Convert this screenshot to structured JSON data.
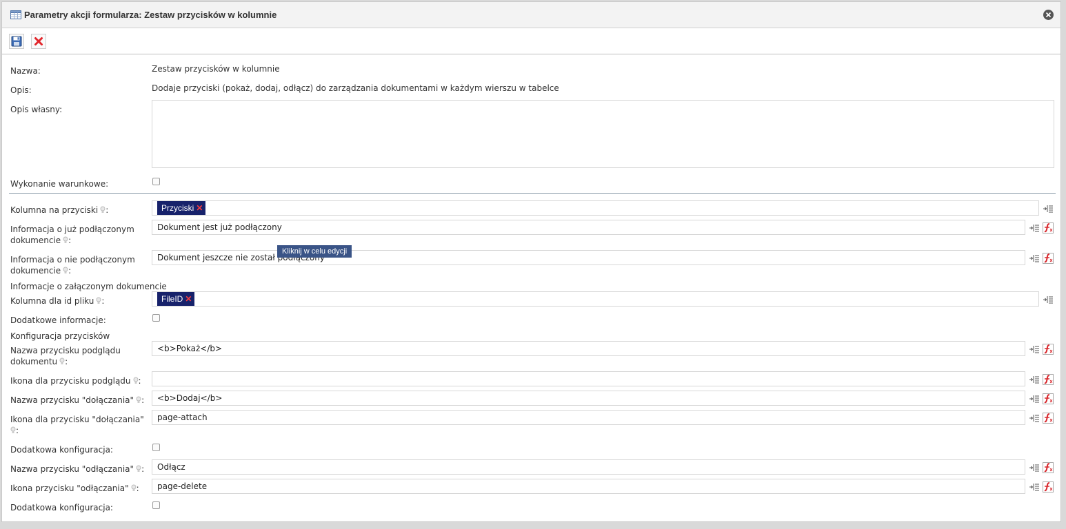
{
  "dialog": {
    "title": "Parametry akcji formularza: Zestaw przycisków w kolumnie"
  },
  "toolbar": {
    "save_icon": "save-disk-icon",
    "cancel_icon": "red-x-icon"
  },
  "fields": {
    "name_label": "Nazwa:",
    "name_value": "Zestaw przycisków w kolumnie",
    "desc_label": "Opis:",
    "desc_value": "Dodaje przyciski (pokaż, dodaj, odłącz) do zarządzania dokumentami w każdym wierszu w tabelce",
    "own_desc_label": "Opis własny:",
    "conditional_label": "Wykonanie warunkowe:",
    "column_label": "Kolumna na przyciski",
    "column_tag": "Przyciski",
    "attached_info_label_1": "Informacja o już podłączonym",
    "attached_info_label_2": "dokumencie",
    "attached_info_value": "Dokument jest już podłączony",
    "not_attached_label_1": "Informacja o nie podłączonym",
    "not_attached_label_2": "dokumencie",
    "not_attached_value": "Dokument jeszcze nie został podłączony",
    "attached_section": "Informacje o załączonym dokumencie",
    "file_id_label": "Kolumna dla id pliku",
    "file_id_tag": "FileID",
    "extra_info_label": "Dodatkowe informacje:",
    "buttons_section": "Konfiguracja przycisków",
    "preview_name_label_1": "Nazwa przycisku podglądu",
    "preview_name_label_2": "dokumentu",
    "preview_name_value": "<b>Pokaż</b>",
    "preview_icon_label": "Ikona dla przycisku podglądu",
    "preview_icon_value": "",
    "attach_name_label": "Nazwa przycisku \"dołączania\"",
    "attach_name_value": "<b>Dodaj</b>",
    "attach_icon_label_1": "Ikona dla przycisku \"dołączania\"",
    "attach_icon_value": "page-attach",
    "extra_config_label": "Dodatkowa konfiguracja:",
    "detach_name_label": "Nazwa przycisku \"odłączania\"",
    "detach_name_value": "Odłącz",
    "detach_icon_label": "Ikona przycisku \"odłączania\"",
    "detach_icon_value": "page-delete",
    "extra_config_label_2": "Dodatkowa konfiguracja:"
  },
  "tooltip": {
    "text": "Kliknij w celu edycji"
  },
  "colon": ":"
}
